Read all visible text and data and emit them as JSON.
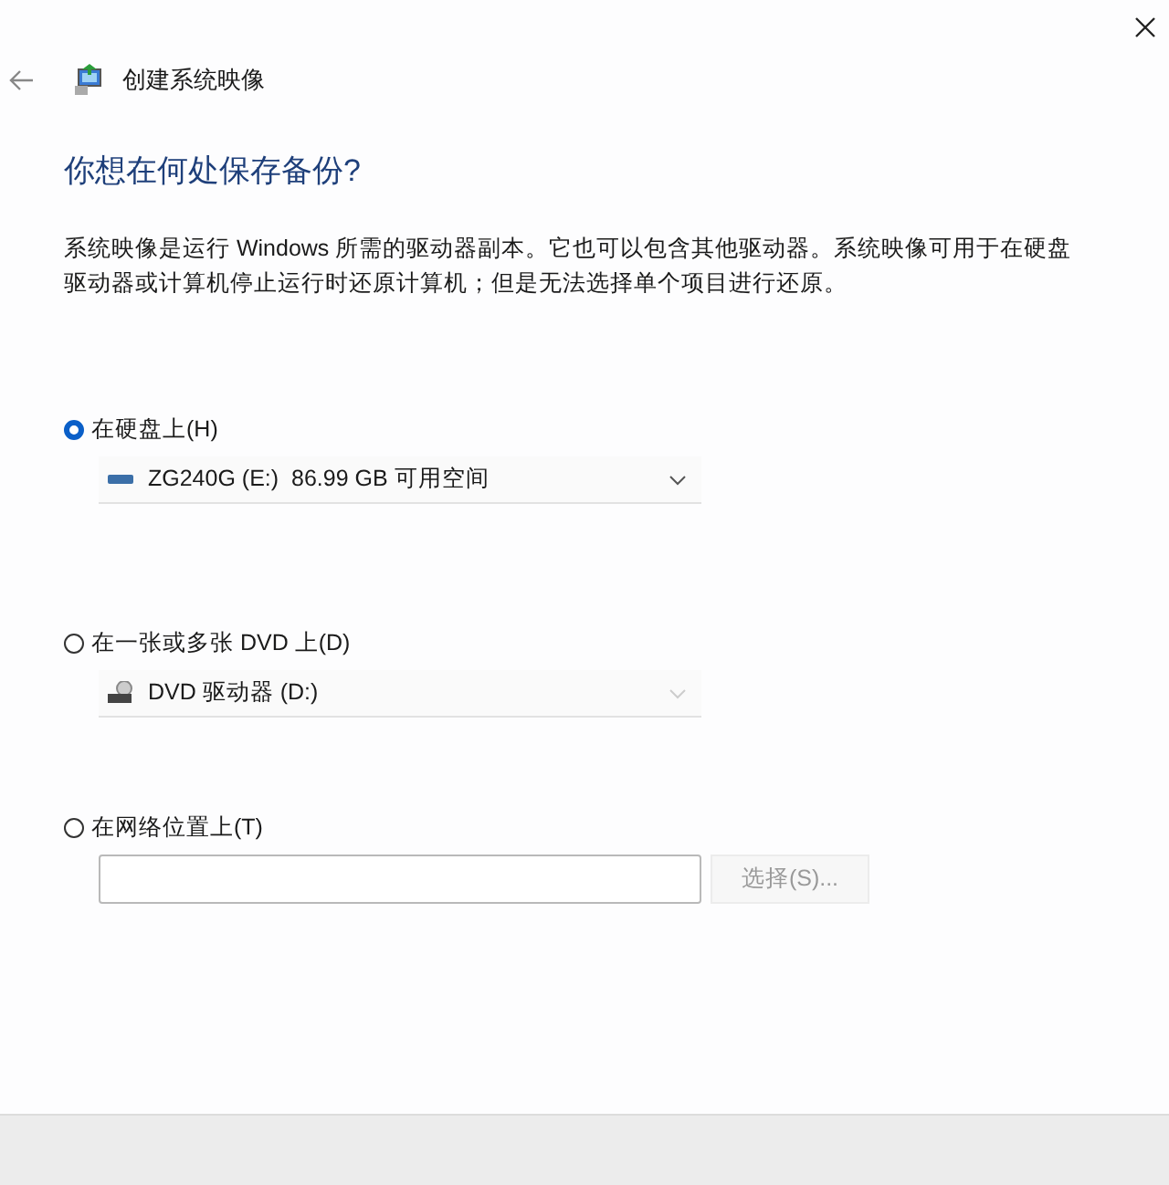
{
  "window": {
    "title": "创建系统映像"
  },
  "heading": "你想在何处保存备份?",
  "description": "系统映像是运行 Windows 所需的驱动器副本。它也可以包含其他驱动器。系统映像可用于在硬盘驱动器或计算机停止运行时还原计算机；但是无法选择单个项目进行还原。",
  "options": [
    {
      "kind": "dropdown",
      "label": "在硬盘上(H)",
      "selected": true,
      "drive": {
        "kind": "hdd",
        "text": "ZG240G (E:)  86.99 GB 可用空间",
        "disabled": false
      }
    },
    {
      "kind": "dropdown",
      "label": "在一张或多张 DVD 上(D)",
      "selected": false,
      "drive": {
        "kind": "dvd",
        "text": "DVD 驱动器 (D:)",
        "disabled": true
      }
    },
    {
      "kind": "path",
      "label": "在网络位置上(T)",
      "selected": false,
      "button": {
        "label": "选择(S)...",
        "disabled": true
      }
    }
  ]
}
